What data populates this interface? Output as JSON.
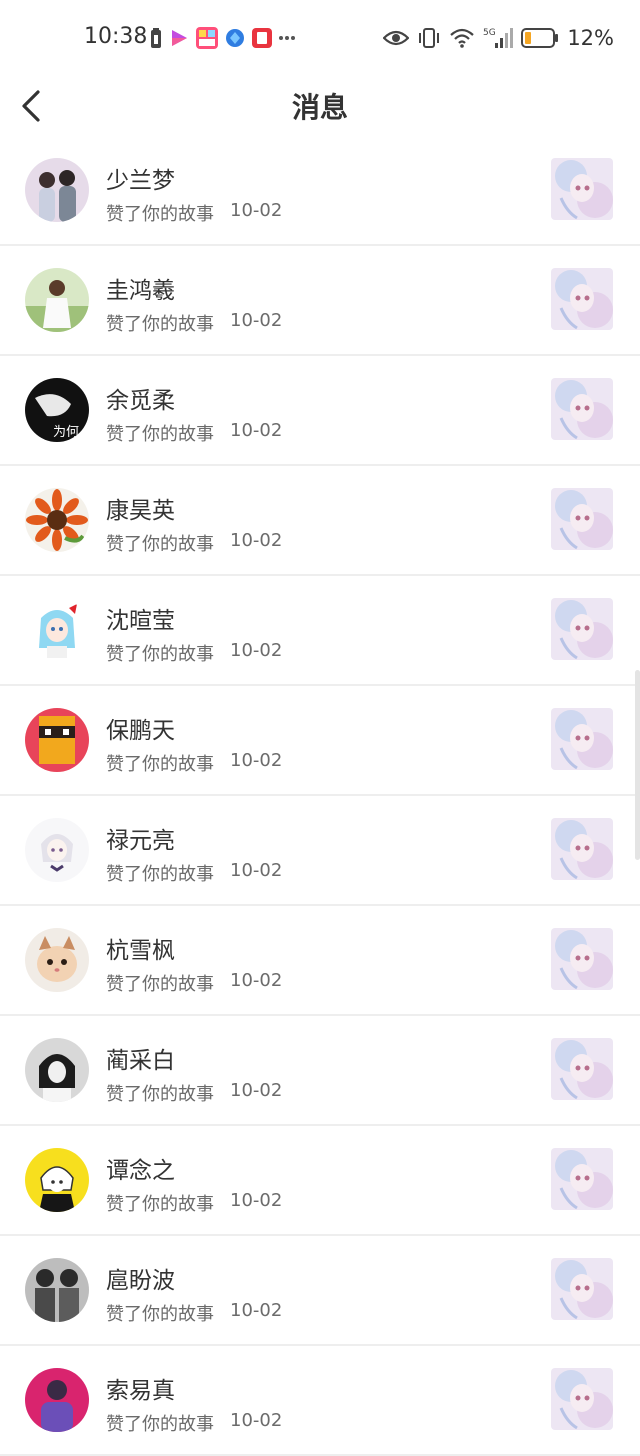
{
  "status_bar": {
    "time": "10:38",
    "network": "5G",
    "battery_percent": "12%"
  },
  "header": {
    "title": "消息",
    "back_icon": "chevron-left-icon"
  },
  "messages": [
    {
      "name": "少兰梦",
      "action": "赞了你的故事",
      "date": "10-02"
    },
    {
      "name": "圭鸿羲",
      "action": "赞了你的故事",
      "date": "10-02"
    },
    {
      "name": "余觅柔",
      "action": "赞了你的故事",
      "date": "10-02",
      "avatar_text": "为何"
    },
    {
      "name": "康昊英",
      "action": "赞了你的故事",
      "date": "10-02"
    },
    {
      "name": "沈暄莹",
      "action": "赞了你的故事",
      "date": "10-02"
    },
    {
      "name": "保鹏天",
      "action": "赞了你的故事",
      "date": "10-02"
    },
    {
      "name": "禄元亮",
      "action": "赞了你的故事",
      "date": "10-02"
    },
    {
      "name": "杭雪枫",
      "action": "赞了你的故事",
      "date": "10-02"
    },
    {
      "name": "蔺采白",
      "action": "赞了你的故事",
      "date": "10-02"
    },
    {
      "name": "谭念之",
      "action": "赞了你的故事",
      "date": "10-02"
    },
    {
      "name": "扈盼波",
      "action": "赞了你的故事",
      "date": "10-02"
    },
    {
      "name": "索易真",
      "action": "赞了你的故事",
      "date": "10-02"
    }
  ],
  "colors": {
    "divider": "#eeeeee",
    "name_text": "#333333",
    "secondary_text": "#6b6b6b",
    "battery_low": "#f5a623"
  }
}
